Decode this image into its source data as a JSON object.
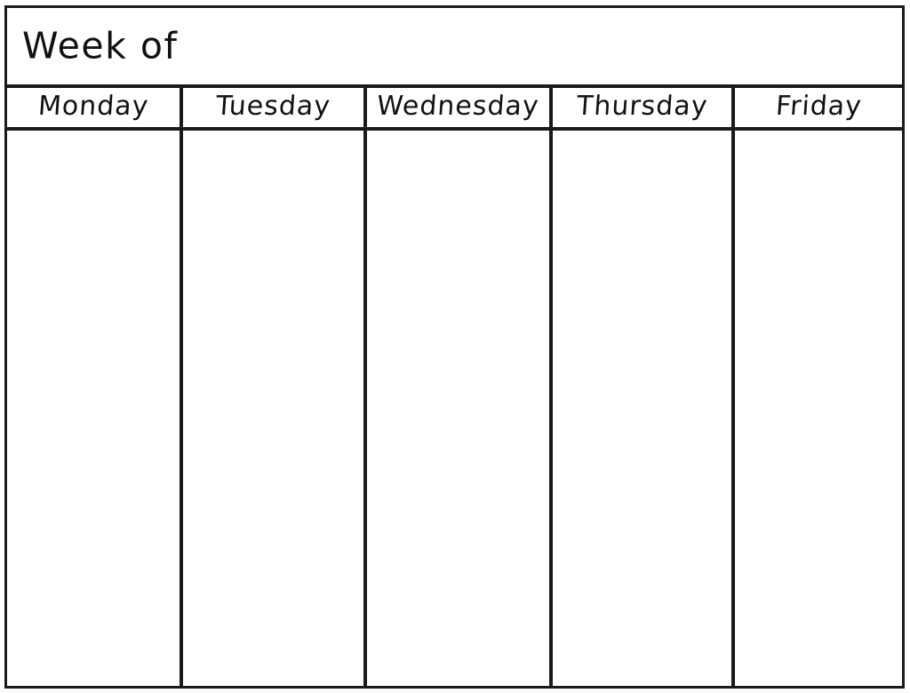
{
  "document": {
    "type": "weekly-planner",
    "title_row": {
      "label": "Week of",
      "fill_in_value": ""
    },
    "columns": [
      {
        "key": "monday",
        "label": "Monday",
        "entries": []
      },
      {
        "key": "tuesday",
        "label": "Tuesday",
        "entries": []
      },
      {
        "key": "wednesday",
        "label": "Wednesday",
        "entries": []
      },
      {
        "key": "thursday",
        "label": "Thursday",
        "entries": []
      },
      {
        "key": "friday",
        "label": "Friday",
        "entries": []
      }
    ],
    "colors": {
      "ink": "#1a1a1a",
      "text": "#111111",
      "paper": "#ffffff"
    }
  }
}
